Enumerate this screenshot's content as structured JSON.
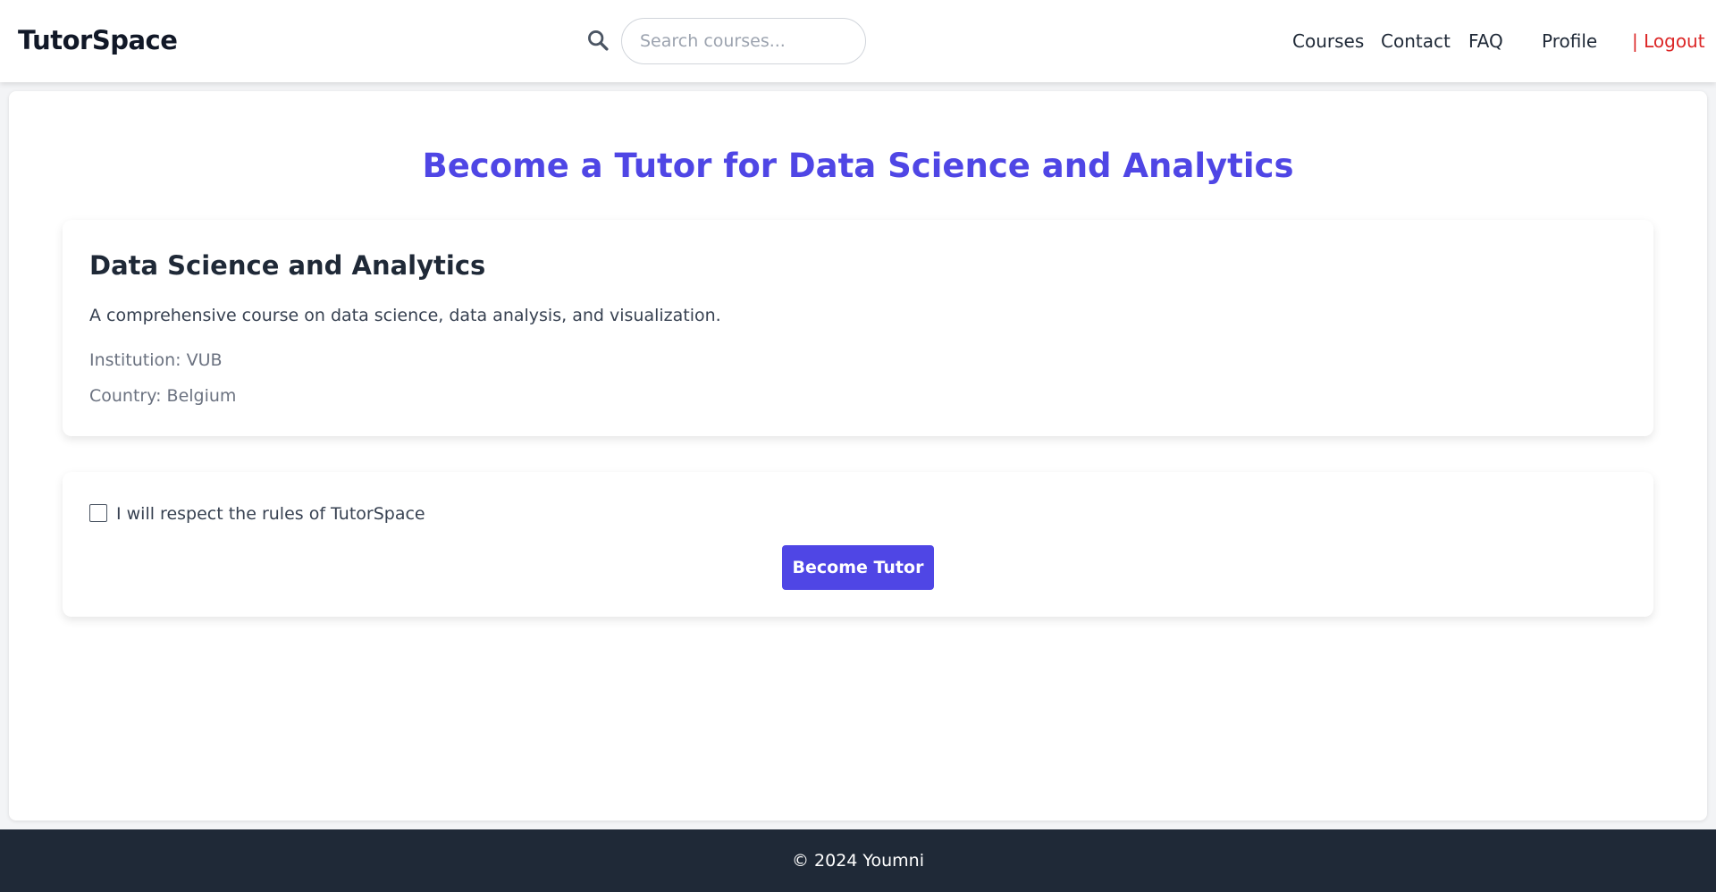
{
  "header": {
    "brand": "TutorSpace",
    "search": {
      "placeholder": "Search courses...",
      "value": ""
    },
    "nav": {
      "courses": "Courses",
      "contact": "Contact",
      "faq": "FAQ",
      "profile": "Profile",
      "logout": "| Logout"
    }
  },
  "main": {
    "title": "Become a Tutor for Data Science and Analytics",
    "course": {
      "name": "Data Science and Analytics",
      "description": "A comprehensive course on data science, data analysis, and visualization.",
      "institution": "Institution: VUB",
      "country": "Country: Belgium"
    },
    "agreement": {
      "label": "I will respect the rules of TutorSpace",
      "checked": false,
      "button_label": "Become Tutor"
    }
  },
  "footer": {
    "text": "© 2024 Youmni"
  },
  "colors": {
    "accent": "#4f46e5",
    "logout": "#dc2626",
    "footer_bg": "#1f2937"
  },
  "icons": {
    "search": "search-icon"
  }
}
